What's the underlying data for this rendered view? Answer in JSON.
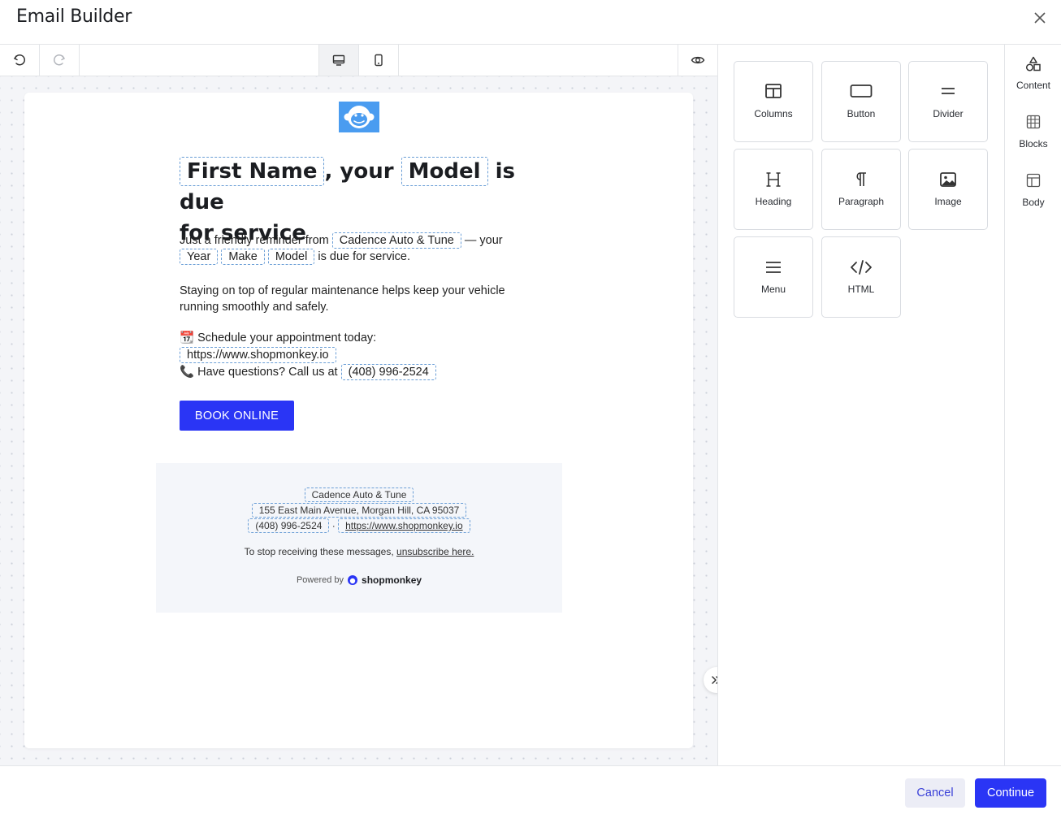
{
  "header": {
    "title": "Email Builder"
  },
  "toolbar": {
    "undo_icon": "undo-icon",
    "redo_icon": "redo-icon",
    "desktop_icon": "desktop-icon",
    "mobile_icon": "mobile-icon",
    "preview_icon": "eye-icon"
  },
  "email": {
    "headline": {
      "first_name": "First Name",
      "part1": ", your",
      "model": "Model",
      "part2": "is due",
      "part3": "for service"
    },
    "reminder": {
      "text1": "Just a friendly reminder from",
      "shop": "Cadence Auto & Tune",
      "text2": "— your",
      "year": "Year",
      "make": "Make",
      "model": "Model",
      "text3": "is due for service."
    },
    "maintenance": "Staying on top of regular maintenance helps keep your vehicle running smoothly and safely.",
    "schedule": {
      "emoji": "📆",
      "text": "Schedule your appointment today:",
      "url": "https://www.shopmonkey.io"
    },
    "questions": {
      "emoji": "📞",
      "text": "Have questions? Call us at",
      "phone": "(408) 996-2524"
    },
    "book_button": "BOOK ONLINE",
    "footer": {
      "shop_name": "Cadence Auto & Tune",
      "address": "155 East Main Avenue, Morgan Hill, CA 95037",
      "phone": "(408) 996-2524",
      "separator": "·",
      "website": "https://www.shopmonkey.io",
      "unsubscribe_text": "To stop receiving these messages,",
      "unsubscribe_link": "unsubscribe here.",
      "powered_by": "Powered by",
      "brand": "shopmonkey"
    }
  },
  "content_tiles": [
    {
      "label": "Columns",
      "icon": "columns-icon"
    },
    {
      "label": "Button",
      "icon": "button-icon"
    },
    {
      "label": "Divider",
      "icon": "divider-icon"
    },
    {
      "label": "Heading",
      "icon": "heading-icon"
    },
    {
      "label": "Paragraph",
      "icon": "paragraph-icon"
    },
    {
      "label": "Image",
      "icon": "image-icon"
    },
    {
      "label": "Menu",
      "icon": "menu-icon"
    },
    {
      "label": "HTML",
      "icon": "code-icon"
    }
  ],
  "side_tabs": [
    {
      "label": "Content",
      "icon": "shapes-icon",
      "active": true
    },
    {
      "label": "Blocks",
      "icon": "blocks-icon",
      "active": false
    },
    {
      "label": "Body",
      "icon": "body-icon",
      "active": false
    }
  ],
  "actions": {
    "cancel": "Cancel",
    "continue": "Continue"
  },
  "colors": {
    "primary": "#2a35f5",
    "logo_bg": "#4a9cf0",
    "tag_border": "#6a9ed6",
    "footer_bg": "#f4f6fa"
  }
}
